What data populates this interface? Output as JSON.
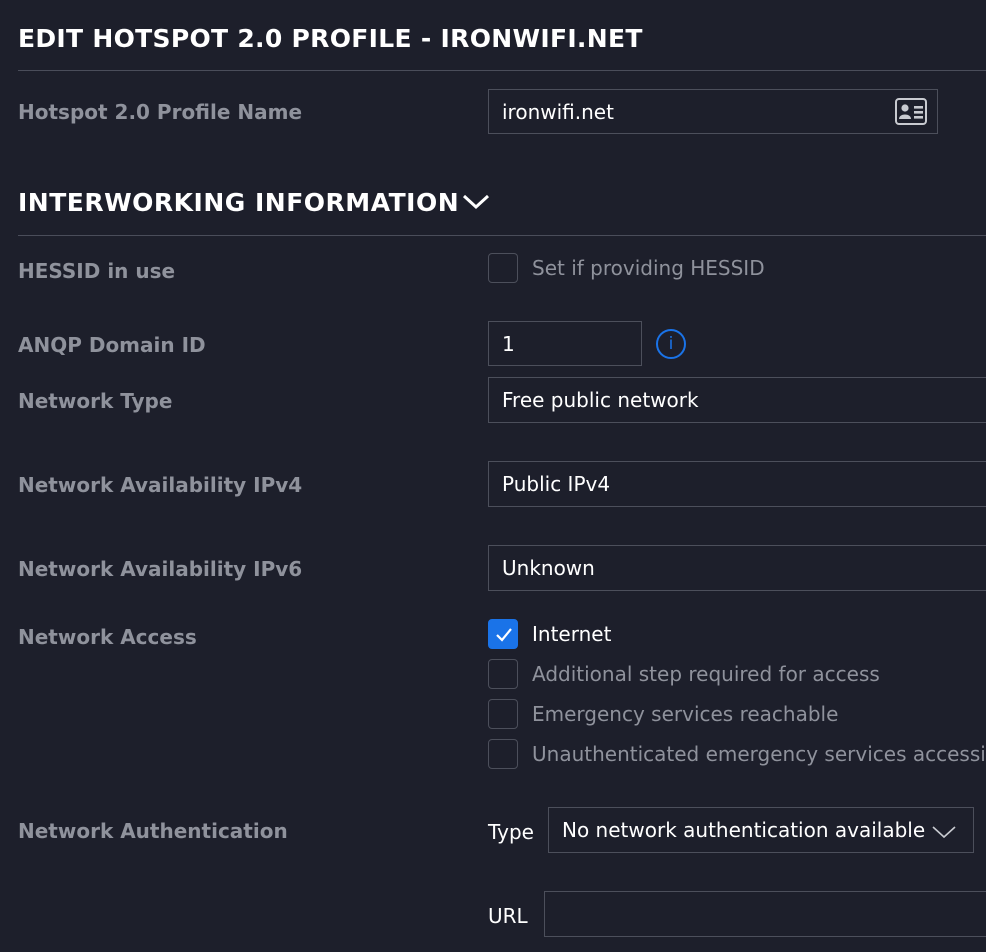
{
  "header": {
    "title": "EDIT HOTSPOT 2.0 PROFILE - IRONWIFI.NET"
  },
  "profile": {
    "name_label": "Hotspot 2.0 Profile Name",
    "name_value": "ironwifi.net",
    "card_icon": "contact-card-icon"
  },
  "interworking": {
    "title": "INTERWORKING INFORMATION",
    "toggle_icon": "chevron-down-icon",
    "hessid": {
      "label": "HESSID in use",
      "checkbox_label": "Set if providing HESSID",
      "checked": false
    },
    "anqp": {
      "label": "ANQP Domain ID",
      "value": "1",
      "info_glyph": "i"
    },
    "network_type": {
      "label": "Network Type",
      "value": "Free public network"
    },
    "ipv4": {
      "label": "Network Availability IPv4",
      "value": "Public IPv4"
    },
    "ipv6": {
      "label": "Network Availability IPv6",
      "value": "Unknown"
    },
    "access": {
      "label": "Network Access",
      "options": [
        {
          "label": "Internet",
          "checked": true
        },
        {
          "label": "Additional step required for access",
          "checked": false
        },
        {
          "label": "Emergency services reachable",
          "checked": false
        },
        {
          "label": "Unauthenticated emergency services accessible",
          "checked": false
        }
      ]
    },
    "auth": {
      "label": "Network Authentication",
      "type_label": "Type",
      "type_value": "No network authentication available",
      "url_label": "URL",
      "url_value": ""
    }
  },
  "colors": {
    "accent": "#1a73e8",
    "background": "#1d1f2b",
    "label": "#8f929c",
    "border": "#4c4f5b"
  }
}
